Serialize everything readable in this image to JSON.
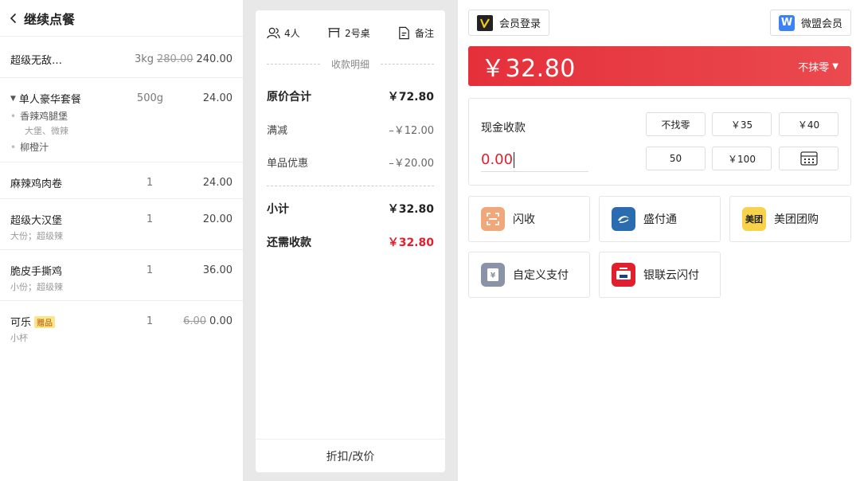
{
  "left": {
    "title": "继续点餐",
    "items": [
      {
        "name": "超级无敌小龙虾爆好吃…",
        "qty": "3kg",
        "orig_price": "280.00",
        "price": "240.00"
      },
      {
        "name": "单人豪华套餐",
        "qty": "500g",
        "price": "24.00",
        "sub_items": [
          {
            "name": "香辣鸡腿堡",
            "note": "大堡、微辣"
          },
          {
            "name": "柳橙汁"
          }
        ]
      },
      {
        "name": "麻辣鸡肉卷",
        "qty": "1",
        "price": "24.00"
      },
      {
        "name": "超级大汉堡",
        "qty": "1",
        "price": "20.00",
        "note": "大份；超级辣"
      },
      {
        "name": "脆皮手撕鸡",
        "qty": "1",
        "price": "36.00",
        "note": "小份；超级辣"
      },
      {
        "name": "可乐",
        "tag": "赠品",
        "qty": "1",
        "orig_price": "6.00",
        "price": "0.00",
        "note": "小杯"
      }
    ]
  },
  "middle": {
    "guests": "4人",
    "table": "2号桌",
    "remark": "备注",
    "section_title": "收款明细",
    "original_total_label": "原价合计",
    "original_total": "￥72.80",
    "full_reduction_label": "满减",
    "full_reduction": "–￥12.00",
    "item_discount_label": "单品优惠",
    "item_discount": "–￥20.00",
    "subtotal_label": "小计",
    "subtotal": "￥32.80",
    "due_label": "还需收款",
    "due": "￥32.80",
    "footer_button": "折扣/改价"
  },
  "right": {
    "member_login": "会员登录",
    "weimeng_member": "微盟会员",
    "amount": "￥32.80",
    "rounding": "不抹零",
    "cash_label": "现金收款",
    "cash_value": "0.00",
    "quick_buttons": [
      "不找零",
      "￥35",
      "￥40",
      "50",
      "￥100"
    ],
    "payments": [
      {
        "label": "闪收",
        "icon": "scan-icon"
      },
      {
        "label": "盛付通",
        "icon": "shengfutong-icon"
      },
      {
        "label": "美团团购",
        "icon": "meituan-icon"
      },
      {
        "label": "自定义支付",
        "icon": "custom-pay-icon"
      },
      {
        "label": "银联云闪付",
        "icon": "unionpay-icon"
      }
    ]
  },
  "colors": {
    "accent": "#e0202c",
    "bar": "#e5303a"
  }
}
